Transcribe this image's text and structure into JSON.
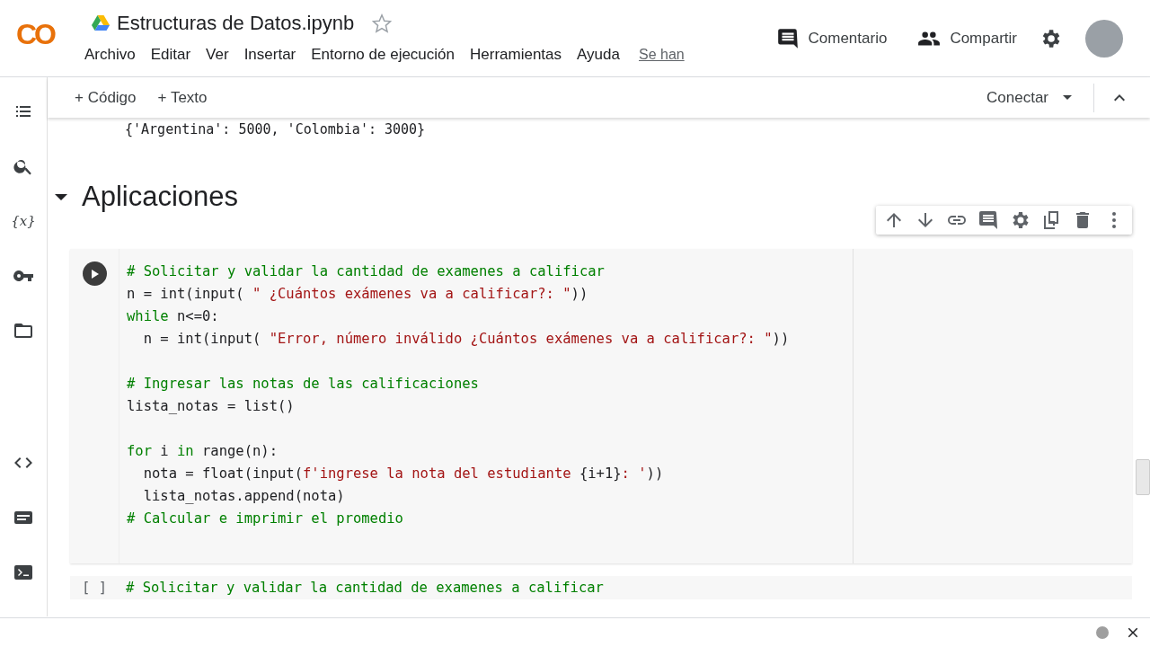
{
  "header": {
    "logo": "CO",
    "title": "Estructuras de Datos.ipynb",
    "starred": false,
    "menu": [
      "Archivo",
      "Editar",
      "Ver",
      "Insertar",
      "Entorno de ejecución",
      "Herramientas",
      "Ayuda"
    ],
    "save_status": "Se han",
    "actions": [
      {
        "kind": "comment",
        "label": "Comentario"
      },
      {
        "kind": "share",
        "label": "Compartir"
      }
    ]
  },
  "toolbar": {
    "add_buttons": [
      "+ Código",
      "+ Texto"
    ],
    "connect": "Conectar"
  },
  "sidebar": {
    "variables_label": "{x}"
  },
  "output": "{'Argentina': 5000, 'Colombia': 3000}",
  "section": {
    "title": "Aplicaciones",
    "expanded": true
  },
  "cell": {
    "blocks": [
      [
        [
          {
            "kind": "comment",
            "text": "# Solicitar y validar la cantidad de examenes a calificar"
          }
        ],
        [
          {
            "kind": "plain",
            "text": "n = int(input( "
          },
          {
            "kind": "string",
            "text": "\" ¿Cuántos exámenes va a calificar?: \""
          },
          {
            "kind": "plain",
            "text": "))"
          }
        ],
        [
          {
            "kind": "keyword",
            "text": "while"
          },
          {
            "kind": "plain",
            "text": " n<=0:"
          }
        ],
        [
          {
            "kind": "plain",
            "text": "  n = int(input( "
          },
          {
            "kind": "string",
            "text": "\"Error, número inválido ¿Cuántos exámenes va a calificar?: \""
          },
          {
            "kind": "plain",
            "text": "))"
          }
        ]
      ],
      [
        [
          {
            "kind": "comment",
            "text": "# Ingresar las notas de las calificaciones"
          }
        ],
        [
          {
            "kind": "plain",
            "text": "lista_notas = list()"
          }
        ]
      ],
      [
        [
          {
            "kind": "keyword",
            "text": "for"
          },
          {
            "kind": "plain",
            "text": " i "
          },
          {
            "kind": "keyword",
            "text": "in"
          },
          {
            "kind": "plain",
            "text": " range(n):"
          }
        ],
        [
          {
            "kind": "plain",
            "text": "  nota = float(input("
          },
          {
            "kind": "string",
            "text": "f'ingrese la nota del estudiante "
          },
          {
            "kind": "plain",
            "text": "{i+1}"
          },
          {
            "kind": "string",
            "text": ": '"
          },
          {
            "kind": "plain",
            "text": "))"
          }
        ],
        [
          {
            "kind": "plain",
            "text": "  lista_notas.append(nota)"
          }
        ],
        [
          {
            "kind": "comment",
            "text": "# Calcular e imprimir el promedio"
          }
        ]
      ]
    ]
  },
  "next_cell": {
    "marker": "[ ]",
    "first_line": "# Solicitar y validar la cantidad de examenes a calificar"
  }
}
